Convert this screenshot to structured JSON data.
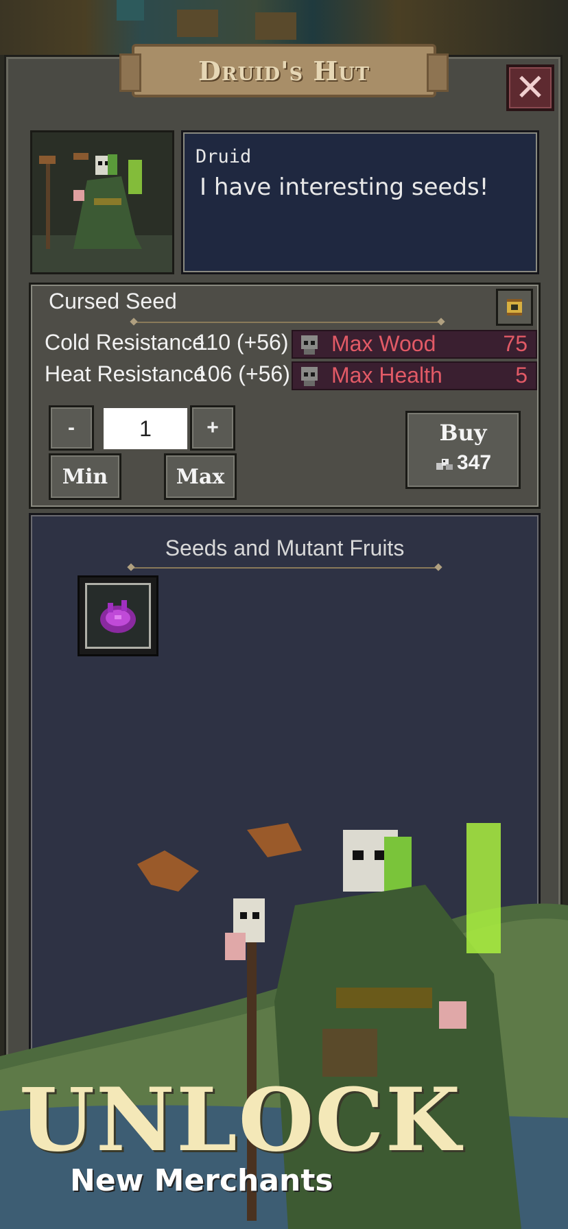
{
  "window": {
    "title": "Druid's Hut",
    "close_symbol": "✕"
  },
  "dialog": {
    "speaker": "Druid",
    "speech": "I have interesting seeds!"
  },
  "item": {
    "name": "Cursed Seed",
    "stats": [
      {
        "label": "Cold Resistance",
        "value": "110 (+56)"
      },
      {
        "label": "Heat Resistance",
        "value": "106 (+56)"
      }
    ],
    "effects": [
      {
        "label": "Max Wood",
        "value": "75"
      },
      {
        "label": "Max Health",
        "value": "5"
      }
    ]
  },
  "quantity": {
    "minus_label": "-",
    "plus_label": "+",
    "value": "1",
    "min_label": "Min",
    "max_label": "Max"
  },
  "buy": {
    "label": "Buy",
    "price": "347"
  },
  "shop": {
    "section_title": "Seeds and Mutant Fruits"
  },
  "promo": {
    "headline": "UNLOCK",
    "subline": "New Merchants"
  },
  "colors": {
    "panel_bg": "#4a4a44",
    "dialog_bg": "#1f2840",
    "shop_bg": "#2e3244",
    "effect_text": "#e25a66",
    "promo_headline": "#f4e8b8"
  },
  "icons": [
    "close-icon",
    "scroll-icon",
    "skull-icon",
    "coin-icon",
    "cursed-seed-icon"
  ]
}
